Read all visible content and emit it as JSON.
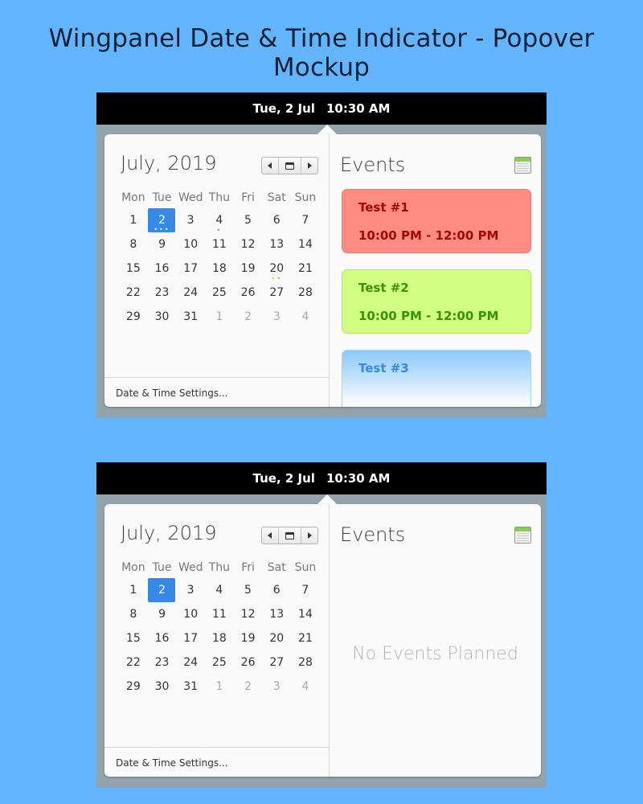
{
  "page_title": "Wingpanel Date & Time Indicator - Popover Mockup",
  "panel": {
    "date": "Tue, 2 Jul",
    "time": "10:30 AM"
  },
  "calendar": {
    "month_label": "July, 2019",
    "weekdays": [
      "Mon",
      "Tue",
      "Wed",
      "Thu",
      "Fri",
      "Sat",
      "Sun"
    ],
    "weeks": [
      [
        "1",
        "2",
        "3",
        "4",
        "5",
        "6",
        "7"
      ],
      [
        "8",
        "9",
        "10",
        "11",
        "12",
        "13",
        "14"
      ],
      [
        "15",
        "16",
        "17",
        "18",
        "19",
        "20",
        "21"
      ],
      [
        "22",
        "23",
        "24",
        "25",
        "26",
        "27",
        "28"
      ],
      [
        "29",
        "30",
        "31",
        "1",
        "2",
        "3",
        "4"
      ]
    ],
    "selected_day": "2",
    "other_month_from_week5_index": 3,
    "settings_label": "Date & Time Settings..."
  },
  "event_dots": {
    "day_2": [
      "#ffffff",
      "#ffffff",
      "#ffffff"
    ],
    "day_4": [
      "#8a7ee6"
    ],
    "day_20": [
      "#d4c42a",
      "#7ecb3a"
    ]
  },
  "events_panel": {
    "title": "Events",
    "events": [
      {
        "name": "Test #1",
        "time": "10:00 PM - 12:00 PM",
        "color": "#ff8c82"
      },
      {
        "name": "Test #2",
        "time": "10:00 PM - 12:00 PM",
        "color": "#d1ff82"
      },
      {
        "name": "Test #3",
        "time": "",
        "color": "#8cc9fd"
      }
    ],
    "empty_text": "No Events Planned"
  },
  "colors": {
    "background": "#63b5fd",
    "accent": "#3689e6"
  }
}
